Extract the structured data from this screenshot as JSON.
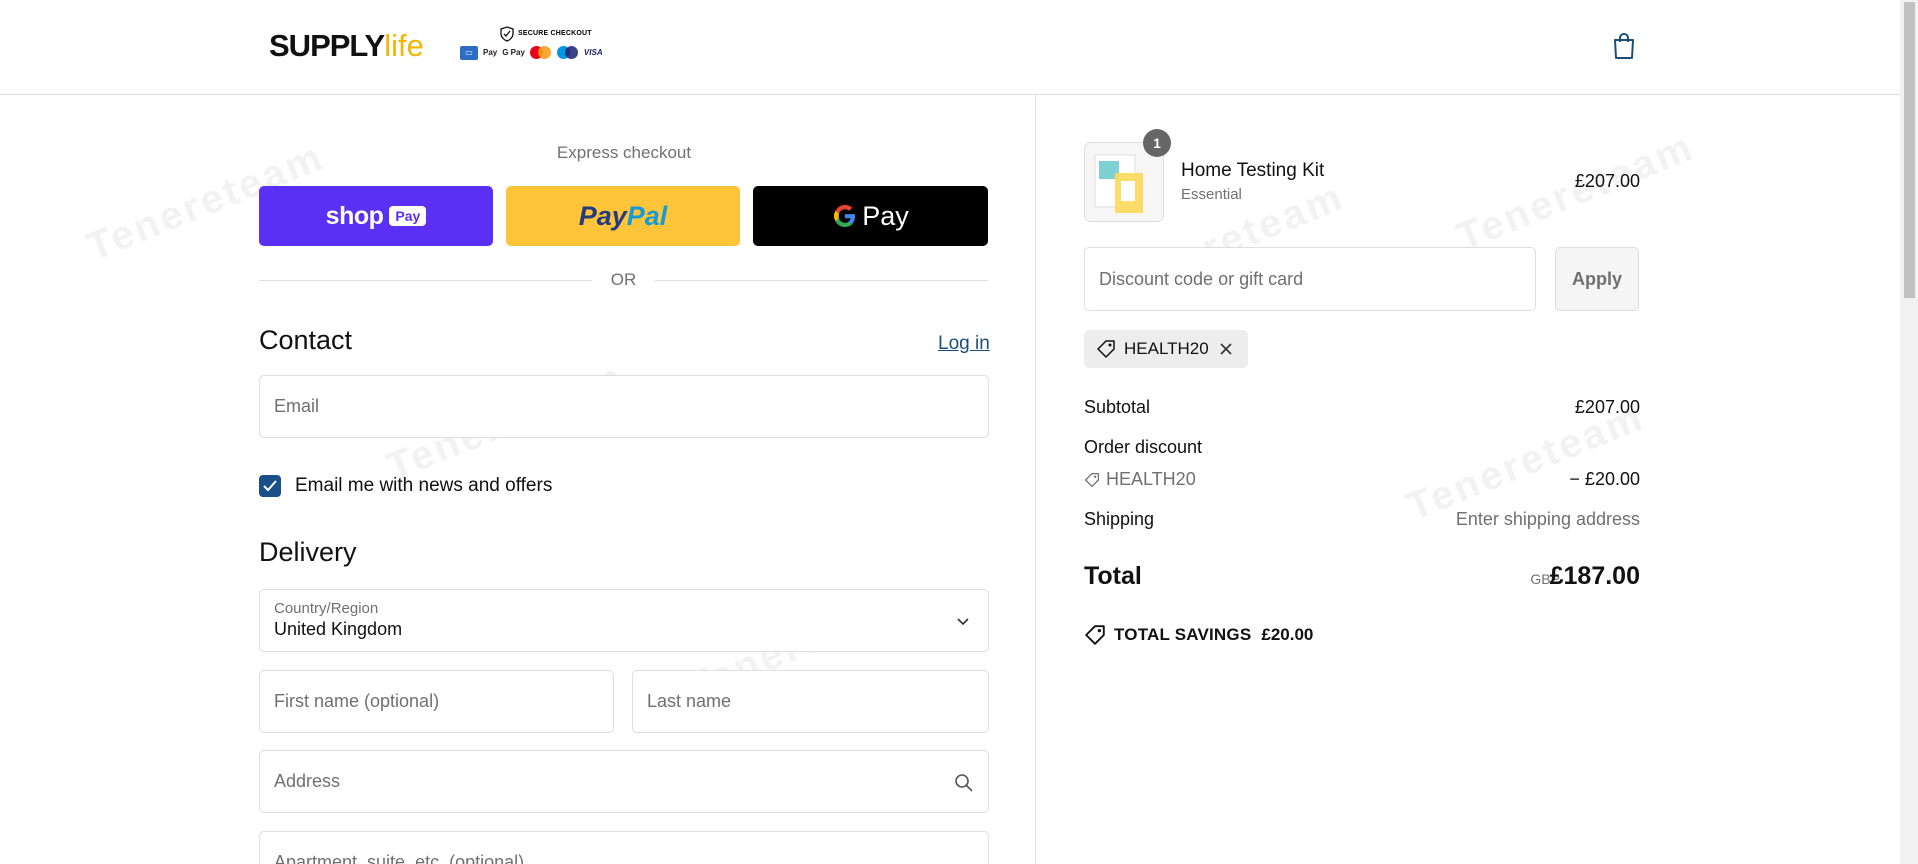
{
  "header": {
    "logo_brand": "SUPPLY",
    "logo_suffix": "life",
    "secure_label": "SECURE CHECKOUT",
    "payment_marks": [
      "AMEX",
      "Pay",
      "G Pay",
      "VISA"
    ]
  },
  "express": {
    "title": "Express checkout",
    "shoppay_word": "shop",
    "shoppay_tag": "Pay",
    "paypal_1": "Pay",
    "paypal_2": "Pal",
    "gpay_g": "G",
    "gpay_word": "Pay",
    "or_text": "OR"
  },
  "contact": {
    "title": "Contact",
    "login_label": "Log in",
    "email_placeholder": "Email",
    "newsletter_label": "Email me with news and offers"
  },
  "delivery": {
    "title": "Delivery",
    "country_label": "Country/Region",
    "country_value": "United Kingdom",
    "first_name_placeholder": "First name (optional)",
    "last_name_placeholder": "Last name",
    "address_placeholder": "Address",
    "apartment_placeholder": "Apartment, suite, etc. (optional)"
  },
  "cart": {
    "item_count": "1",
    "item_name": "Home Testing Kit",
    "item_variant": "Essential",
    "item_price": "£207.00",
    "discount_placeholder": "Discount code or gift card",
    "apply_label": "Apply",
    "applied_code": "HEALTH20"
  },
  "summary": {
    "subtotal_label": "Subtotal",
    "subtotal_value": "£207.00",
    "order_discount_label": "Order discount",
    "discount_code": "HEALTH20",
    "discount_value": "− £20.00",
    "shipping_label": "Shipping",
    "shipping_value": "Enter shipping address",
    "total_label": "Total",
    "total_currency": "GBP",
    "total_value": "£187.00",
    "savings_label": "TOTAL SAVINGS",
    "savings_value": "£20.00"
  },
  "watermark": "Tenereteam",
  "colors": {
    "shoppay": "#5a31f4",
    "paypal": "#ffc439",
    "gpay": "#000000",
    "link": "#1b4f7a",
    "checkbox": "#1b4f8a",
    "logo_accent": "#f2b705"
  }
}
